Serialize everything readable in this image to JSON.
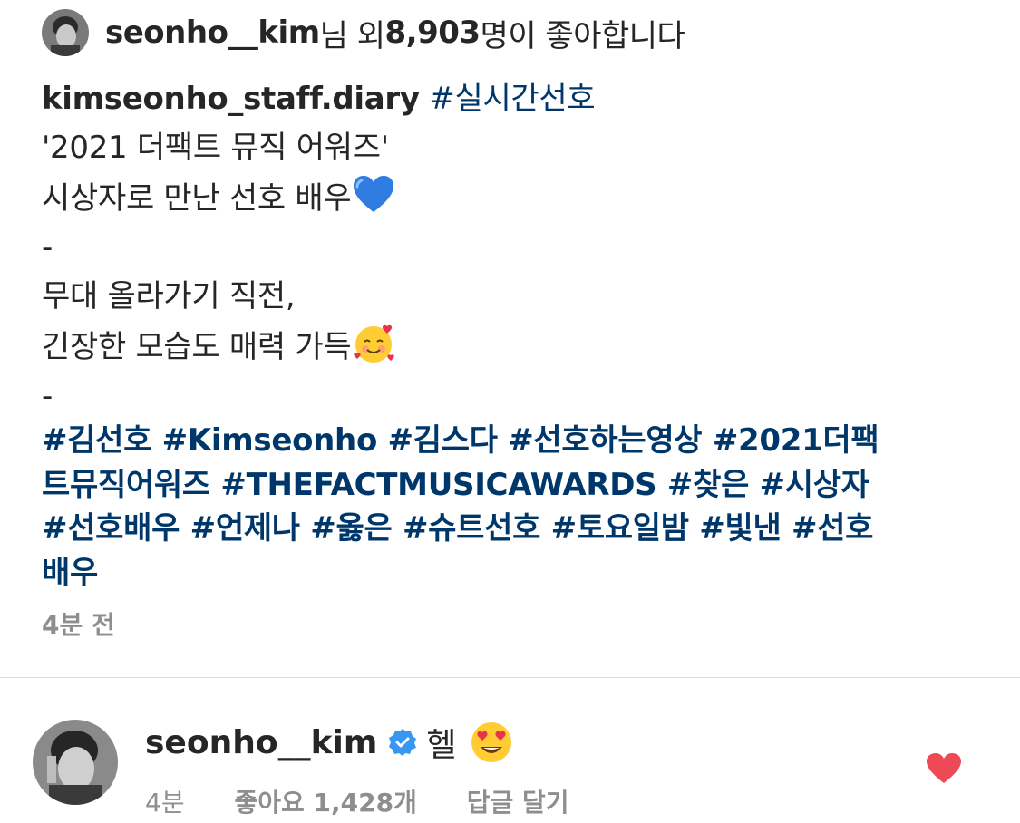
{
  "likes": {
    "user": "seonho__kim",
    "suffix_1": "님 외 ",
    "count": "8,903",
    "suffix_2": "명이 좋아합니다"
  },
  "caption": {
    "author": "kimseonho_staff.diary",
    "lead_tag": "#실시간선호",
    "lines": [
      "'2021 더팩트 뮤직 어워즈'",
      "시상자로 만난 선호 배우",
      "-",
      "무대 올라가기 직전,",
      "긴장한 모습도 매력 가득",
      "-"
    ],
    "hashtag_lines": [
      "#김선호 #Kimseonho #김스다 #선호하는영상 #2021더팩",
      "트뮤직어워즈 #THEFACTMUSICAWARDS #찾은 #시상자",
      "#선호배우 #언제나 #옳은 #슈트선호 #토요일밤 #빛낸 #선호",
      "배우"
    ],
    "timestamp": "4분 전"
  },
  "comment": {
    "user": "seonho__kim",
    "text": "헬",
    "time": "4분",
    "likes": "좋아요 1,428개",
    "reply": "답글 달기"
  },
  "icons": {
    "blue_heart": "blue-heart-emoji",
    "smiling_hearts": "smiling-face-with-hearts-emoji",
    "heart_eyes": "heart-eyes-emoji",
    "verified": "verified-badge-icon",
    "like": "heart-icon"
  },
  "colors": {
    "hashtag": "#00376b",
    "text": "#262626",
    "muted": "#8e8e8e",
    "like_red": "#ed4956",
    "verified_blue": "#3897f0"
  }
}
